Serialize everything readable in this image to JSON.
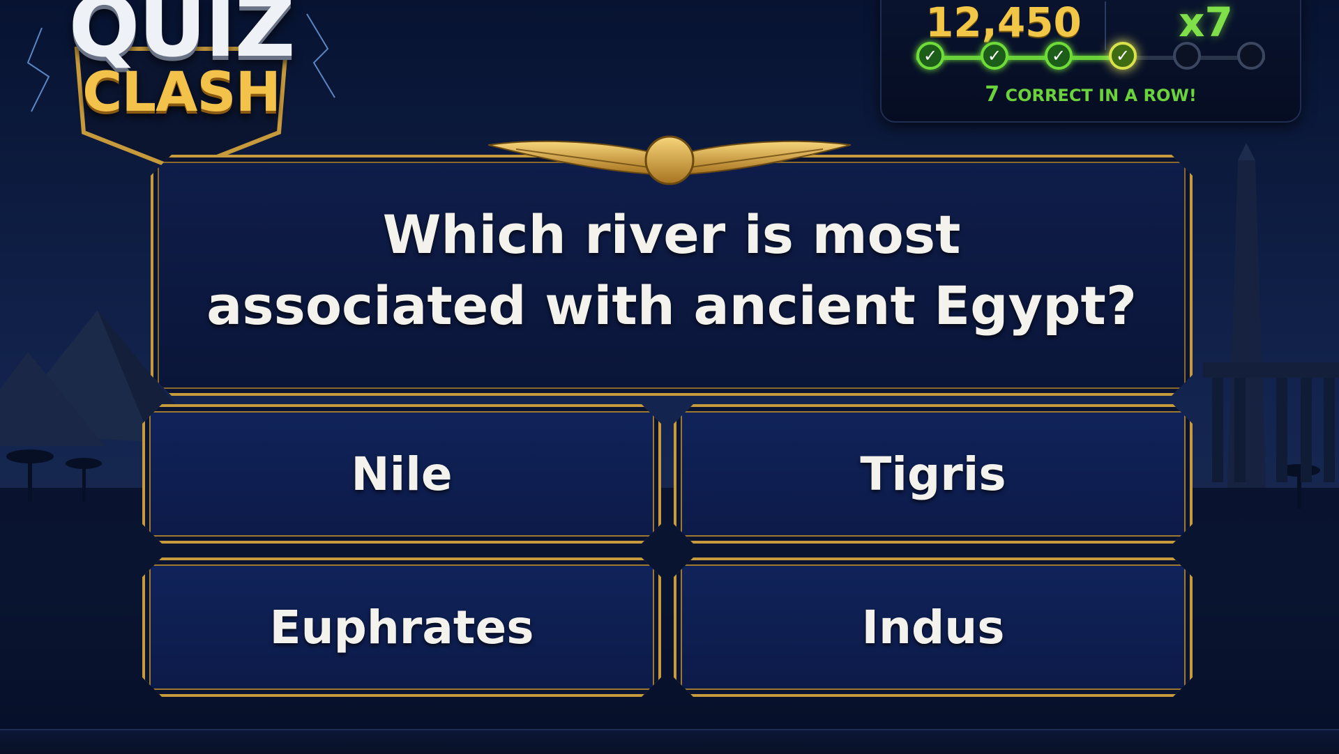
{
  "logo": {
    "line1": "QUIZ",
    "line2": "CLASH"
  },
  "hud": {
    "score": "12,450",
    "multiplier": "x7",
    "streak": {
      "count": "7",
      "label": "CORRECT IN A ROW!",
      "steps": [
        "done",
        "done",
        "done",
        "current",
        "empty",
        "empty"
      ],
      "check_glyph": "✓"
    }
  },
  "question": {
    "line1": "Which river is most",
    "line2": "associated with ancient Egypt?"
  },
  "answers": [
    {
      "label": "Nile"
    },
    {
      "label": "Tigris"
    },
    {
      "label": "Euphrates"
    },
    {
      "label": "Indus"
    }
  ],
  "icons": {
    "emblem": "winged-sun-disk-icon",
    "check": "check-icon"
  },
  "colors": {
    "gold": "#c79a3b",
    "score_gold": "#f2c747",
    "streak_green": "#6fdc3a",
    "panel_blue": "#0f1d4a"
  }
}
